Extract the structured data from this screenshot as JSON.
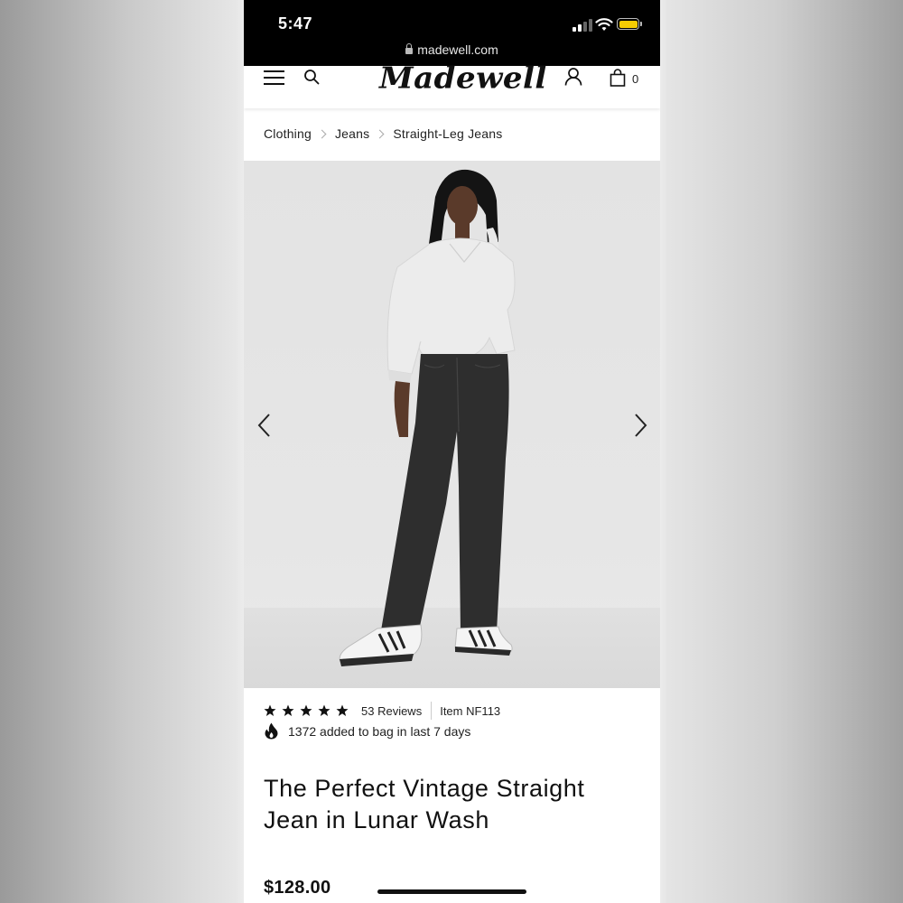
{
  "status_bar": {
    "time": "5:47",
    "url": "madewell.com",
    "battery_color": "#f6cc02"
  },
  "header": {
    "brand": "Madewell",
    "bag_count": "0",
    "icons": [
      "menu-icon",
      "search-icon",
      "account-icon",
      "bag-icon"
    ]
  },
  "breadcrumb": [
    "Clothing",
    "Jeans",
    "Straight-Leg Jeans"
  ],
  "product": {
    "rating_stars": 5,
    "reviews": "53 Reviews",
    "item_number": "Item NF113",
    "popularity": "1372 added to bag in last 7 days",
    "title": "The Perfect Vintage Straight Jean in Lunar Wash",
    "price": "$128.00"
  },
  "carousel": {
    "icons": [
      "chevron-left-icon",
      "chevron-right-icon"
    ]
  }
}
